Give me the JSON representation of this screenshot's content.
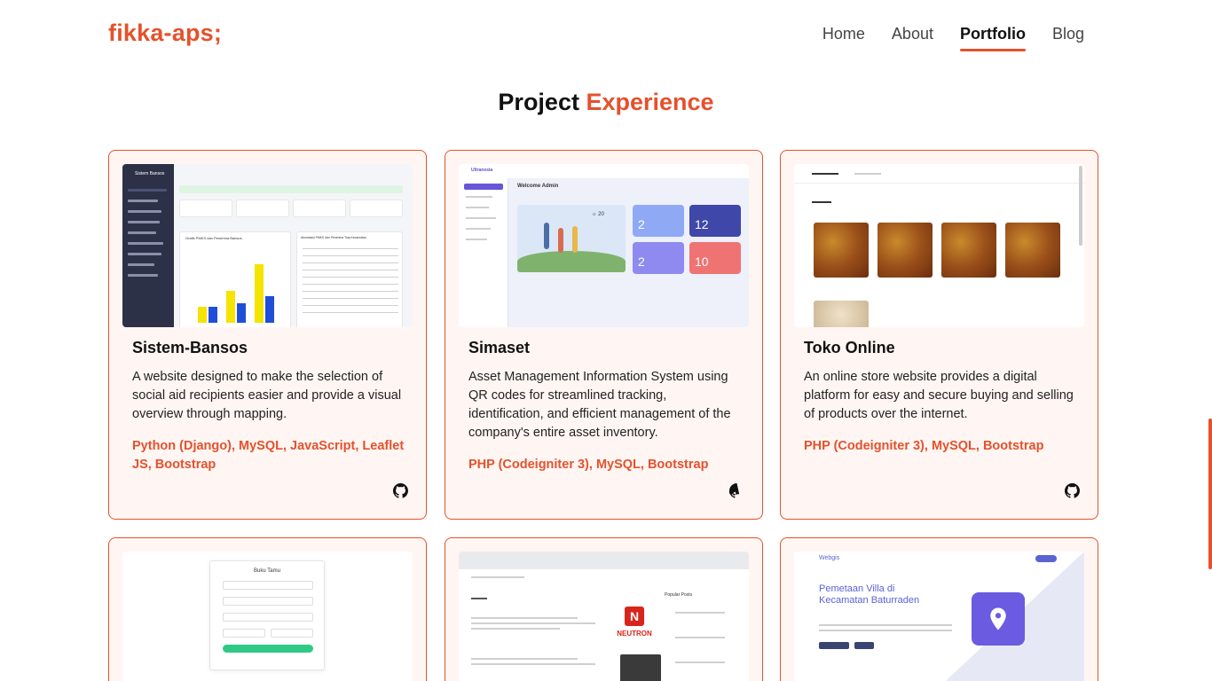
{
  "brand": "fikka-aps;",
  "nav": [
    {
      "label": "Home",
      "active": false
    },
    {
      "label": "About",
      "active": false
    },
    {
      "label": "Portfolio",
      "active": true
    },
    {
      "label": "Blog",
      "active": false
    }
  ],
  "section": {
    "title_main": "Project",
    "title_accent": "Experience"
  },
  "projects": [
    {
      "title": "Sistem-Bansos",
      "description": "A website designed to make the selection of social aid recipients easier and provide a visual overview through mapping.",
      "tech": "Python (Django), MySQL, JavaScript, Leaflet JS, Bootstrap",
      "thumb": {
        "app": "Sistem Bansos",
        "chart_title": "Grafik PMKS dan Penerima Bansos",
        "table_title": "Akumulasi PMKS dan Penerima Tiap Kecamatan"
      }
    },
    {
      "title": "Simaset",
      "description": "Asset Management Information System using QR codes for streamlined tracking, identification, and efficient management of the company's entire asset inventory.",
      "tech": "PHP (Codeigniter 3), MySQL, Bootstrap",
      "thumb": {
        "app": "Ultranesia",
        "welcome": "Welcome Admin",
        "tiles": [
          "2",
          "12",
          "2",
          "10"
        ]
      }
    },
    {
      "title": "Toko Online",
      "description": "An online store website provides a digital platform for easy and secure buying and selling of products over the internet.",
      "tech": "PHP (Codeigniter 3), MySQL, Bootstrap",
      "thumb": {}
    },
    {
      "title": "",
      "description": "",
      "tech": "",
      "thumb": {
        "form_title": "Buku Tamu"
      }
    },
    {
      "title": "",
      "description": "",
      "tech": "",
      "thumb": {
        "brand_text": "NEUTRON",
        "section": "Popular Posts"
      }
    },
    {
      "title": "",
      "description": "",
      "tech": "",
      "thumb": {
        "logo": "Webgis",
        "headline": "Pemetaan Villa di Kecamatan Baturraden"
      }
    }
  ],
  "colors": {
    "accent": "#e5512c",
    "card_bg": "#fff6f3",
    "sidebar": "#2c3148"
  },
  "icons": {
    "repo": "github-icon"
  }
}
